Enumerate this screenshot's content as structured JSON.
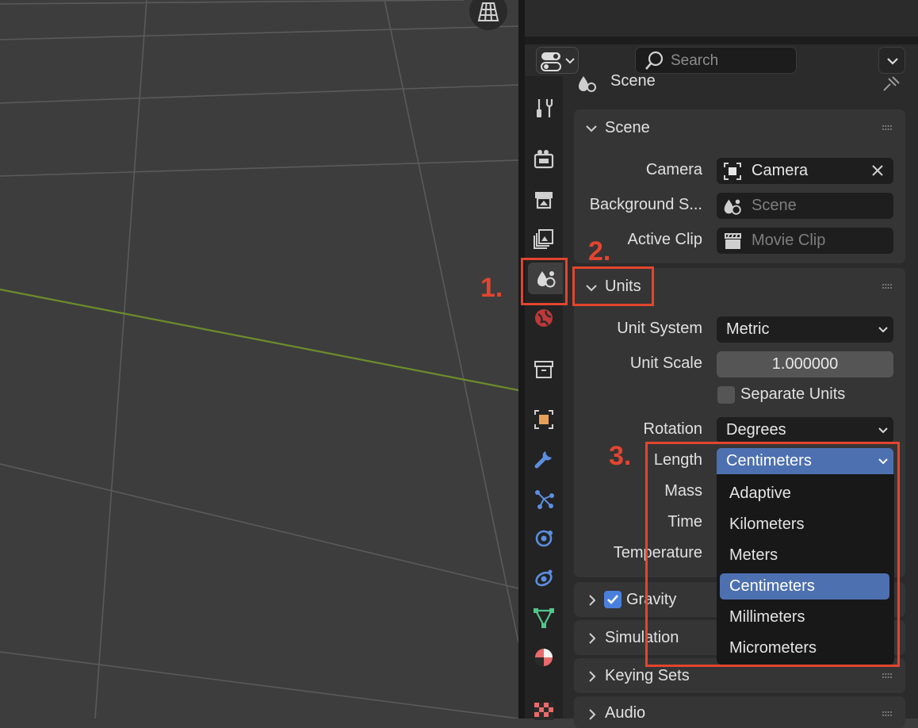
{
  "header": {
    "search_placeholder": "Search"
  },
  "context": {
    "title": "Scene"
  },
  "scene_panel": {
    "title": "Scene",
    "camera_label": "Camera",
    "camera_value": "Camera",
    "background_label": "Background S...",
    "background_value": "Scene",
    "clip_label": "Active Clip",
    "clip_value": "Movie Clip"
  },
  "units_panel": {
    "title": "Units",
    "unit_system_label": "Unit System",
    "unit_system_value": "Metric",
    "unit_scale_label": "Unit Scale",
    "unit_scale_value": "1.000000",
    "separate_units_label": "Separate Units",
    "rotation_label": "Rotation",
    "rotation_value": "Degrees",
    "length_label": "Length",
    "length_value": "Centimeters",
    "mass_label": "Mass",
    "time_label": "Time",
    "temperature_label": "Temperature"
  },
  "length_dropdown": {
    "options": [
      "Adaptive",
      "Kilometers",
      "Meters",
      "Centimeters",
      "Millimeters",
      "Micrometers"
    ],
    "selected": "Centimeters"
  },
  "collapsed_panels": {
    "gravity": "Gravity",
    "simulation": "Simulation",
    "keying_sets": "Keying Sets",
    "audio": "Audio"
  },
  "annotations": {
    "step1": "1.",
    "step2": "2.",
    "step3": "3."
  },
  "colors": {
    "accent_blue": "#4d70b0",
    "annotation_red": "#e2452f",
    "checkbox_blue": "#4a80dd"
  }
}
